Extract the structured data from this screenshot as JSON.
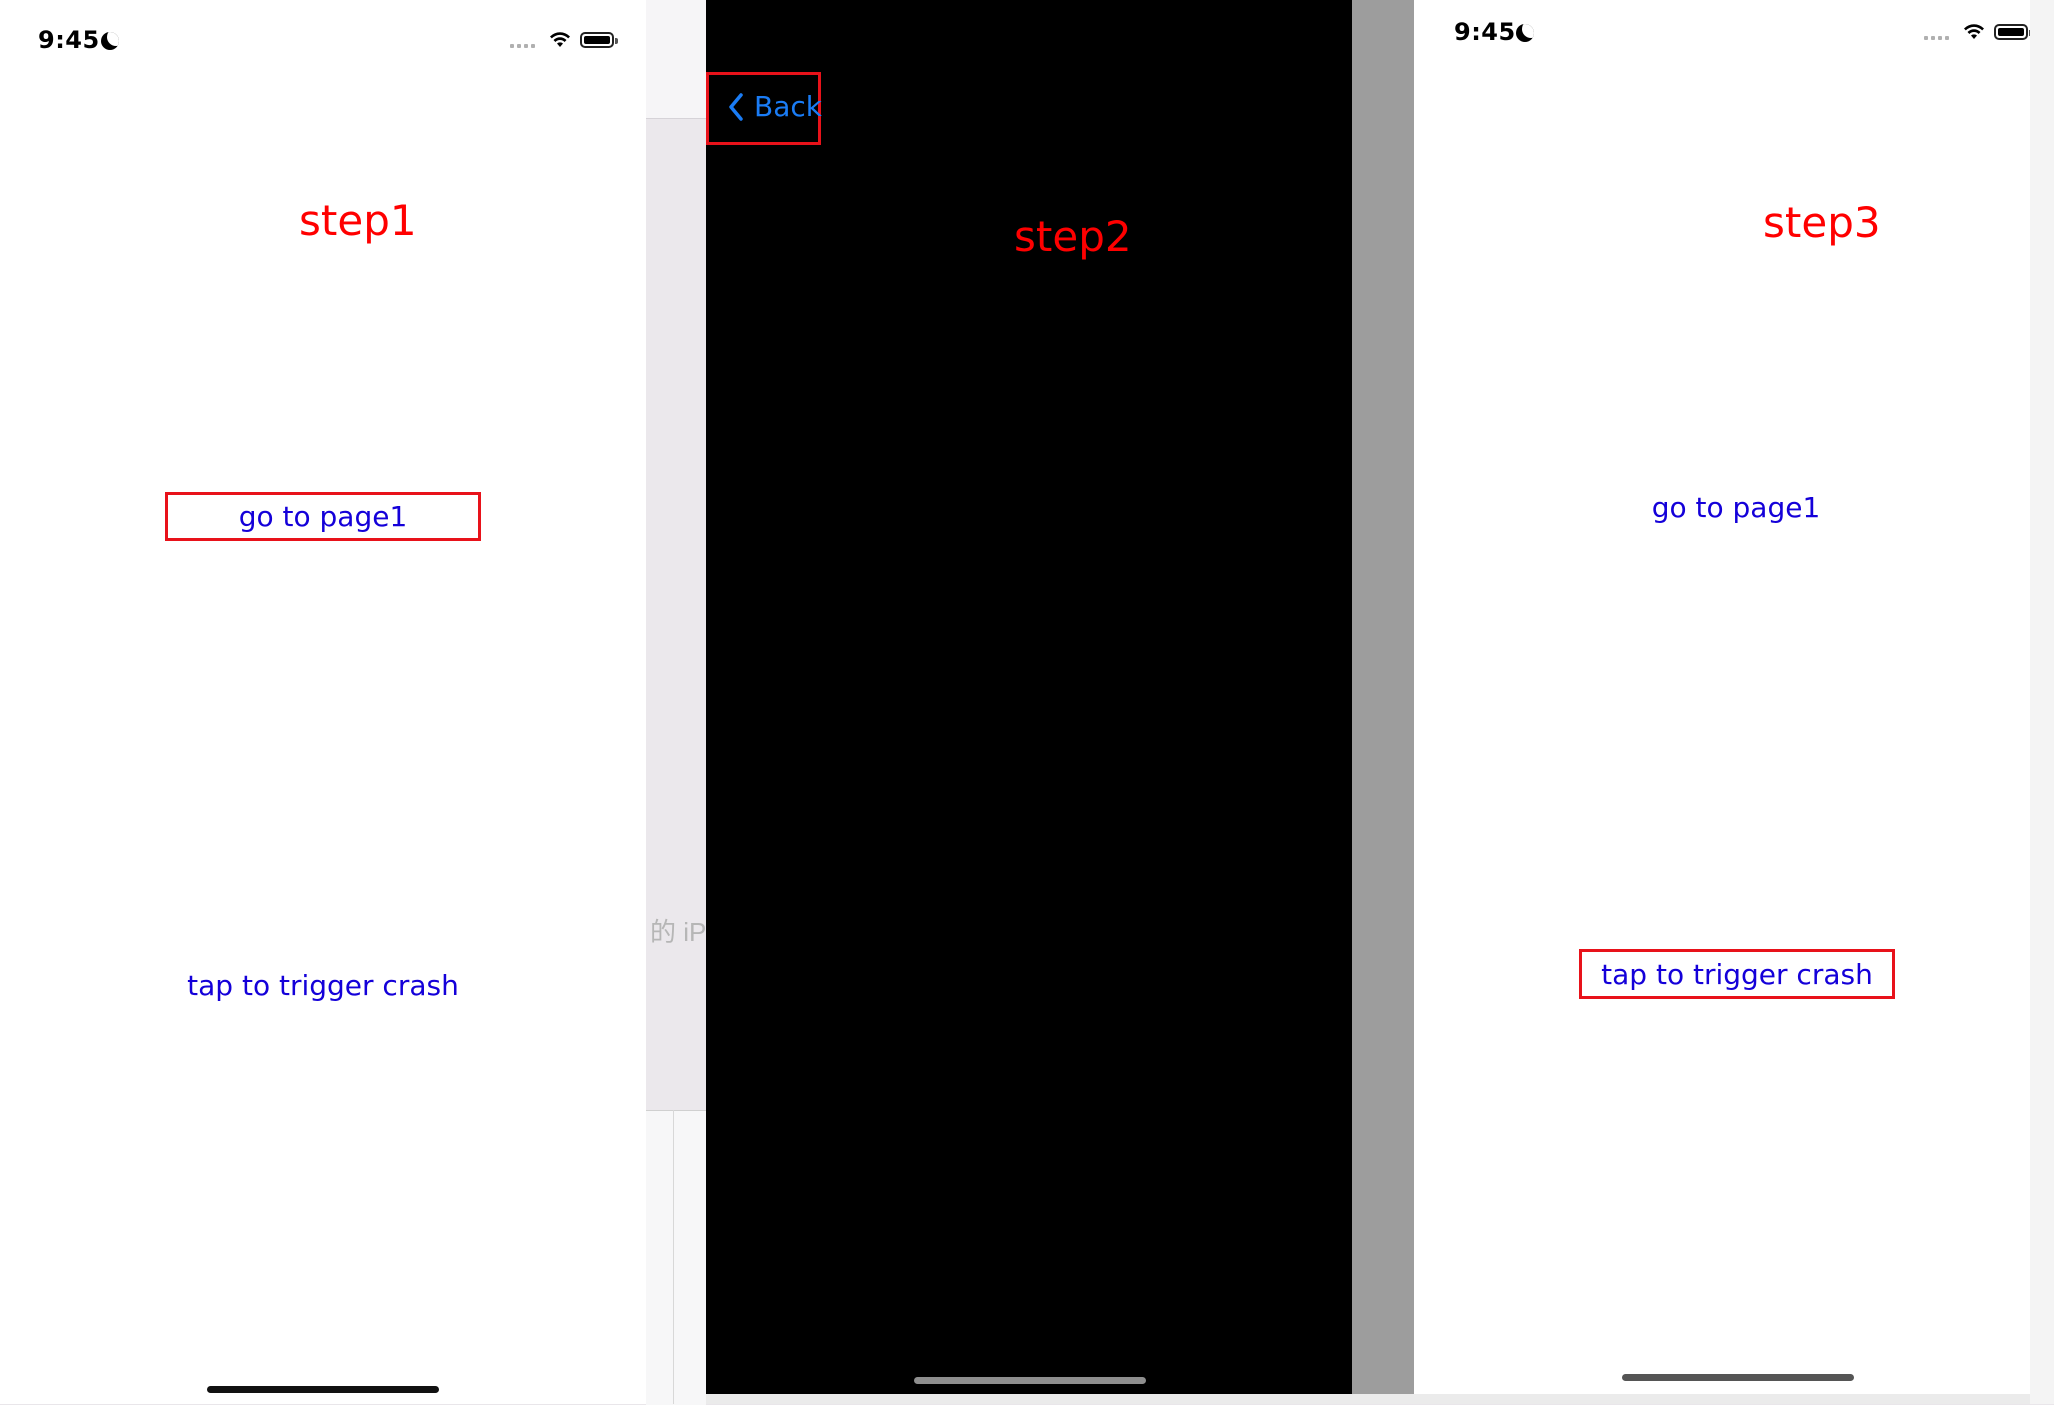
{
  "background": {
    "partial_text": "的 iP"
  },
  "screens": [
    {
      "status_time": "9:45",
      "step_label": "step1",
      "go_to_page_label": "go to page1",
      "crash_label": "tap to trigger crash"
    },
    {
      "back_label": "Back",
      "step_label": "step2"
    },
    {
      "status_time": "9:45",
      "step_label": "step3",
      "go_to_page_label": "go to page1",
      "crash_label": "tap to trigger crash"
    }
  ],
  "colors": {
    "step_label": "#ff0000",
    "link": "#1400d9",
    "back_link": "#1a7cf5",
    "highlight_border": "#e8121a"
  }
}
